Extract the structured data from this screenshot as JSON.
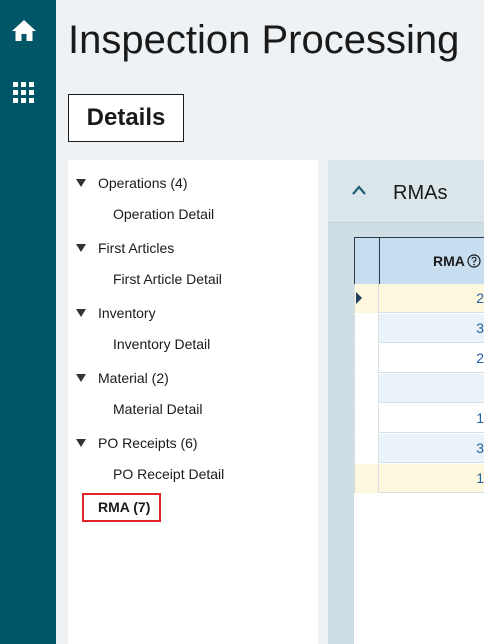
{
  "app": {
    "title": "Inspection Processing",
    "accent": "#005566",
    "highlight_border": "#e0242a"
  },
  "rail": {
    "items": [
      {
        "icon": "home-icon"
      },
      {
        "icon": "apps-grid-icon"
      }
    ]
  },
  "details_button": {
    "label": "Details"
  },
  "tree": {
    "items": [
      {
        "label": "Operations (4)",
        "child": "Operation Detail"
      },
      {
        "label": "First Articles",
        "child": "First Article Detail"
      },
      {
        "label": "Inventory",
        "child": "Inventory Detail"
      },
      {
        "label": "Material (2)",
        "child": "Material Detail"
      },
      {
        "label": "PO Receipts (6)",
        "child": "PO Receipt Detail"
      }
    ],
    "selected": {
      "label": "RMA (7)"
    }
  },
  "panel": {
    "title": "RMAs",
    "grid": {
      "column_header": "RMA",
      "rows": [
        {
          "value": "2",
          "highlight": true,
          "current": true
        },
        {
          "value": "3",
          "highlight": false
        },
        {
          "value": "2",
          "highlight": false
        },
        {
          "value": "",
          "highlight": false
        },
        {
          "value": "1",
          "highlight": false
        },
        {
          "value": "3",
          "highlight": false
        },
        {
          "value": "1",
          "highlight": true
        }
      ]
    }
  }
}
